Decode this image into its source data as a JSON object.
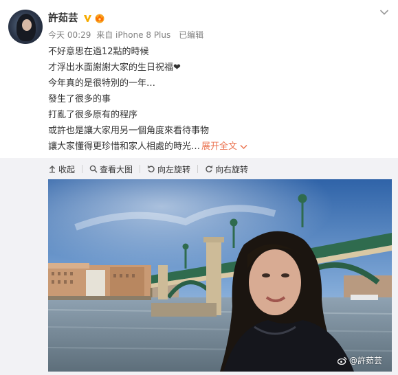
{
  "author": {
    "name": "許茹芸",
    "avatar_icon": "avatar-photo",
    "badges": [
      "verified-v-icon",
      "vip-crown-icon"
    ]
  },
  "meta": {
    "time": "今天 00:29",
    "source": "来自 iPhone 8 Plus",
    "edited": "已编辑"
  },
  "post": {
    "lines": [
      "不好意思在過12點的時候",
      "才浮出水面謝謝大家的生日祝福❤",
      "今年真的是很特別的一年…",
      "發生了很多的事",
      "打亂了很多原有的程序",
      "或許也是讓大家用另一個角度來看待事物",
      "讓大家懂得更珍惜和家人相處的時光…"
    ],
    "expand_label": "展开全文"
  },
  "toolbar": {
    "collapse": "收起",
    "view_large": "查看大图",
    "rotate_left": "向左旋转",
    "rotate_right": "向右旋转"
  },
  "photo": {
    "description_icon": "selfie-by-river-bridge-photo",
    "watermark": "@許茹芸"
  },
  "colors": {
    "link": "#eb7350",
    "text": "#333333",
    "meta": "#808080",
    "panel": "#f2f2f5",
    "verified": "#f6ab00"
  }
}
